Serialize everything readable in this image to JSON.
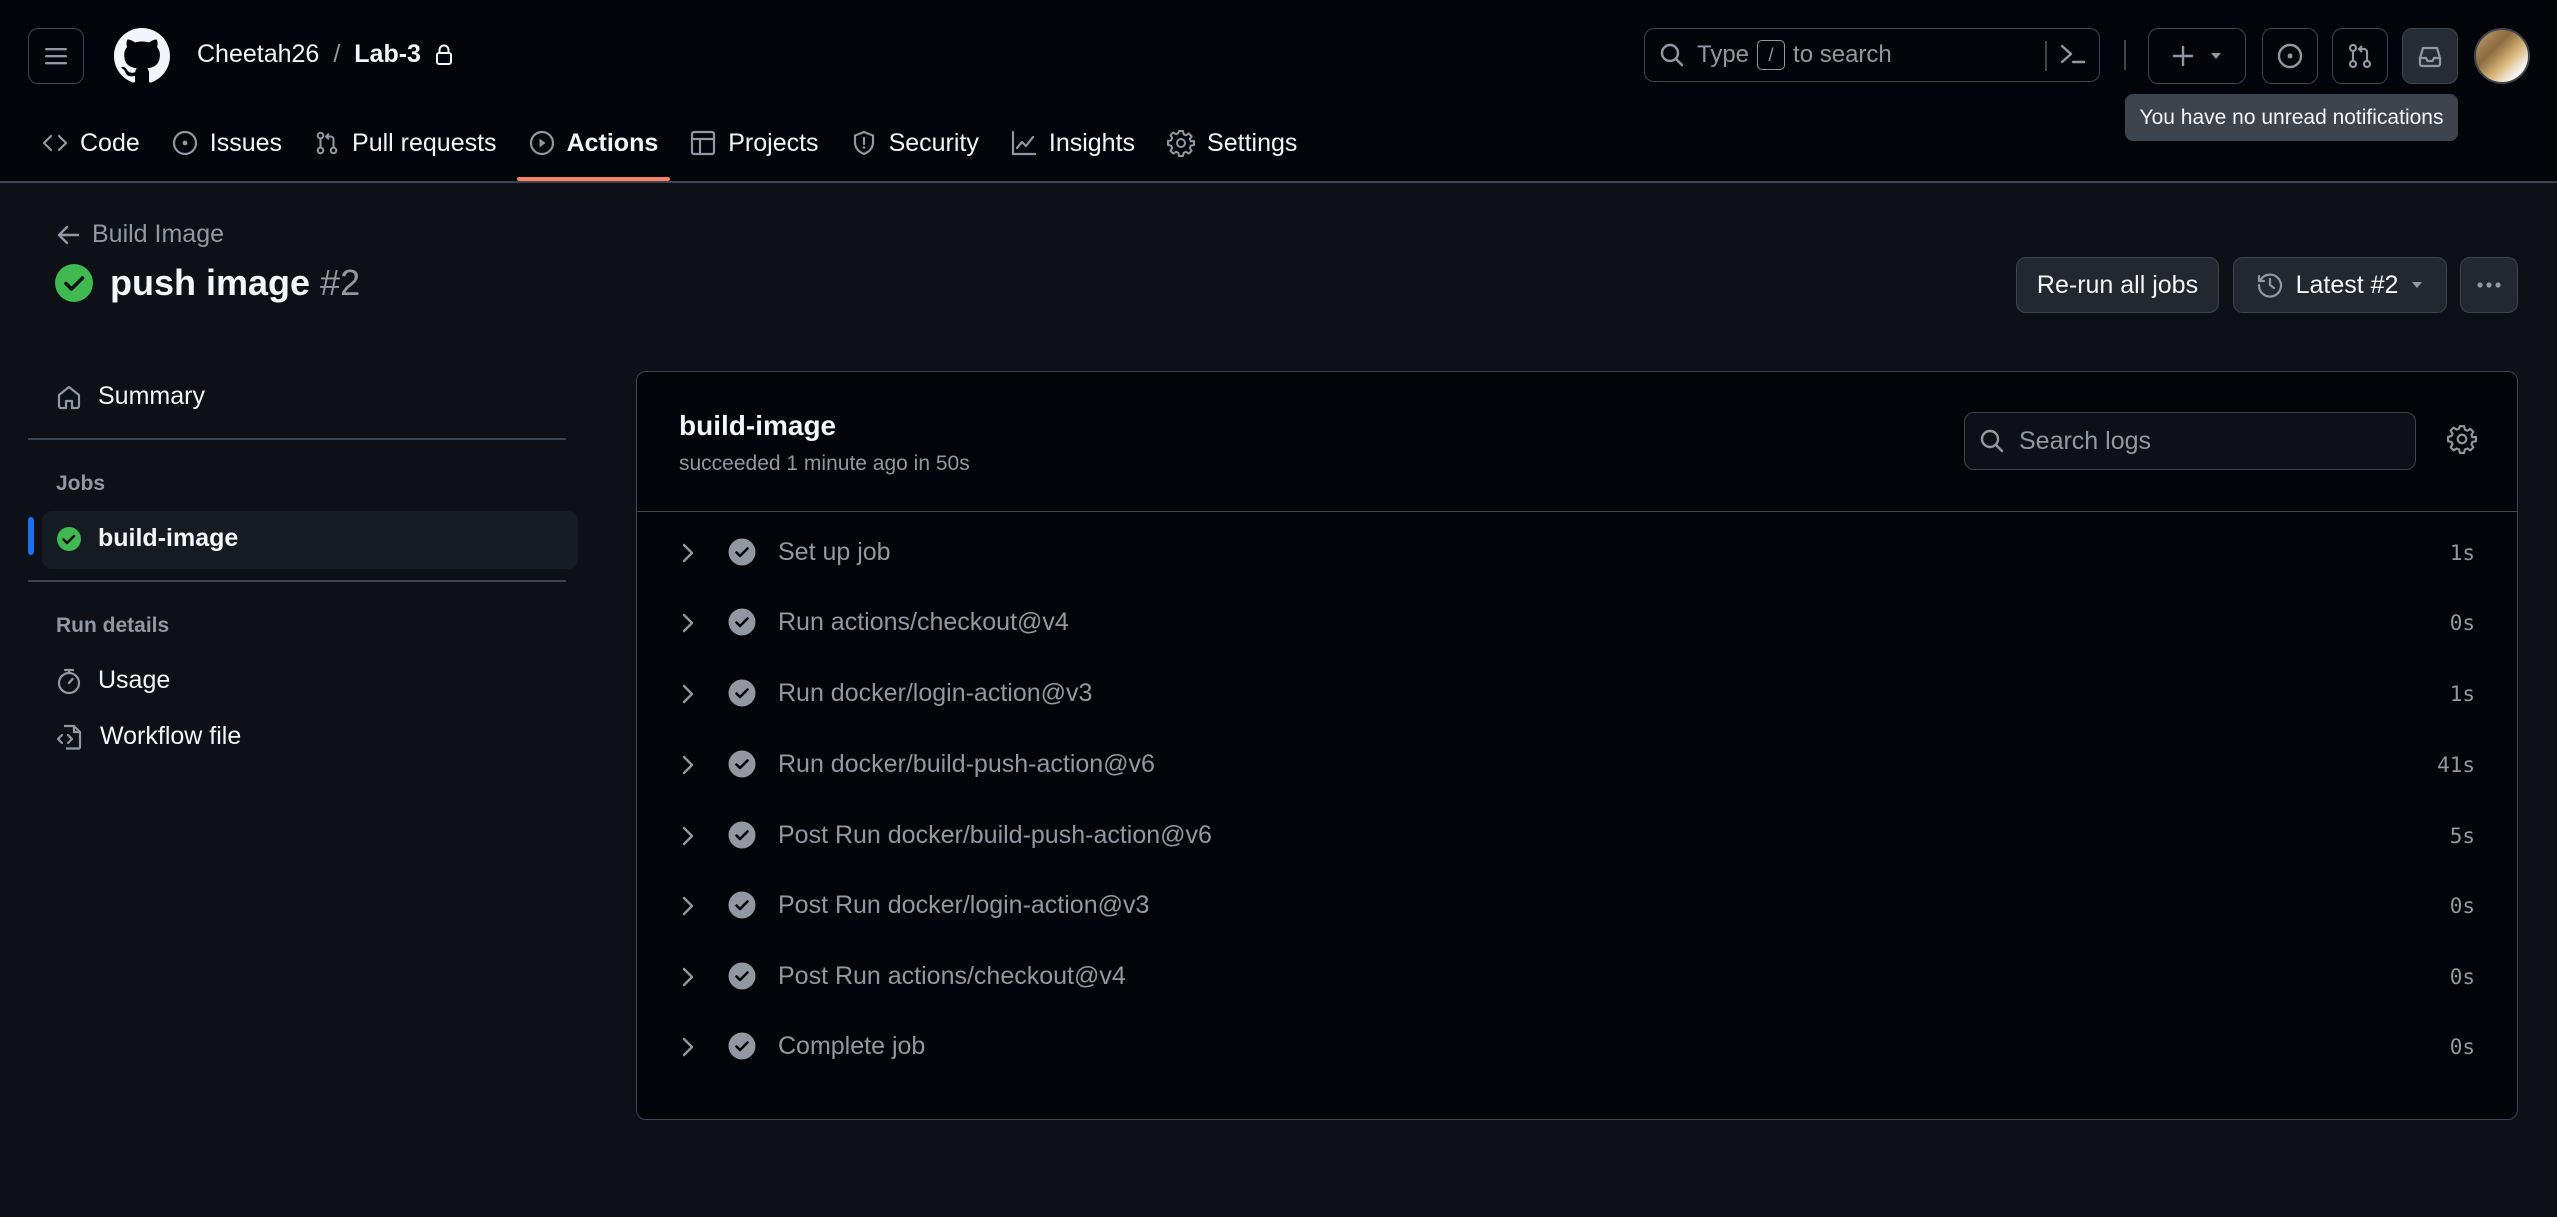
{
  "header": {
    "owner": "Cheetah26",
    "separator": "/",
    "repo": "Lab-3",
    "search": {
      "prefix": "Type",
      "key": "/",
      "suffix": "to search"
    },
    "tooltip": "You have no unread notifications"
  },
  "nav": {
    "tabs": [
      {
        "label": "Code",
        "icon": "code-icon"
      },
      {
        "label": "Issues",
        "icon": "issue-opened-icon"
      },
      {
        "label": "Pull requests",
        "icon": "git-pull-request-icon"
      },
      {
        "label": "Actions",
        "icon": "play-icon",
        "active": true
      },
      {
        "label": "Projects",
        "icon": "table-icon"
      },
      {
        "label": "Security",
        "icon": "shield-icon"
      },
      {
        "label": "Insights",
        "icon": "graph-icon"
      },
      {
        "label": "Settings",
        "icon": "gear-icon"
      }
    ]
  },
  "run": {
    "back_label": "Build Image",
    "title": "push image",
    "number": "#2",
    "status": "success",
    "rerun_label": "Re-run all jobs",
    "attempt_label": "Latest #2"
  },
  "sidebar": {
    "summary_label": "Summary",
    "jobs_heading": "Jobs",
    "jobs": [
      {
        "label": "build-image",
        "status": "success",
        "selected": true
      }
    ],
    "run_details_heading": "Run details",
    "details": [
      {
        "label": "Usage",
        "icon": "stopwatch-icon"
      },
      {
        "label": "Workflow file",
        "icon": "file-code-icon"
      }
    ]
  },
  "job": {
    "title": "build-image",
    "subtitle": "succeeded 1 minute ago in 50s",
    "search_placeholder": "Search logs",
    "steps": [
      {
        "label": "Set up job",
        "duration": "1s"
      },
      {
        "label": "Run actions/checkout@v4",
        "duration": "0s"
      },
      {
        "label": "Run docker/login-action@v3",
        "duration": "1s"
      },
      {
        "label": "Run docker/build-push-action@v6",
        "duration": "41s"
      },
      {
        "label": "Post Run docker/build-push-action@v6",
        "duration": "5s"
      },
      {
        "label": "Post Run docker/login-action@v3",
        "duration": "0s"
      },
      {
        "label": "Post Run actions/checkout@v4",
        "duration": "0s"
      },
      {
        "label": "Complete job",
        "duration": "0s"
      }
    ]
  },
  "colors": {
    "success": "#3fb950",
    "accent_underline": "#f78166",
    "selected_indicator": "#1f6feb",
    "muted": "#9198a1"
  }
}
